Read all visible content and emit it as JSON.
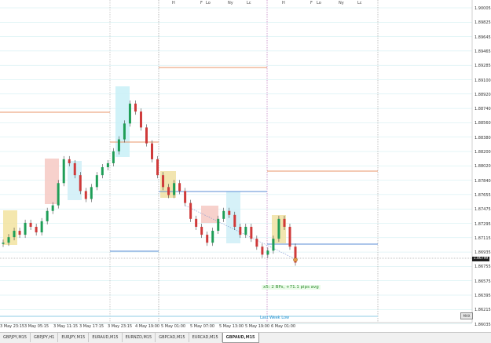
{
  "chart": {
    "symbol": "GBPAUD",
    "timeframe": "M15",
    "current_price_label": "1.86799",
    "stats_text": "x5: 2 BPs, +71.1 pips avg",
    "last_week_low_label": "Last Week Low",
    "corner_button": "MAX"
  },
  "session_labels": [
    "H",
    "F",
    "Lo",
    "Ny",
    "Lc",
    "H",
    "F",
    "Lo",
    "Ny",
    "Lc"
  ],
  "price_axis": [
    "1.90005",
    "1.89825",
    "1.89645",
    "1.89465",
    "1.89285",
    "1.89100",
    "1.88920",
    "1.88740",
    "1.88560",
    "1.88380",
    "1.88200",
    "1.88020",
    "1.87840",
    "1.87655",
    "1.87475",
    "1.87295",
    "1.87115",
    "1.86935",
    "1.86755",
    "1.86575",
    "1.86395",
    "1.86215",
    "1.86035"
  ],
  "time_axis": [
    "3 May 23:15",
    "3 May 05:15",
    "3 May 11:15",
    "3 May 17:15",
    "3 May 23:15",
    "4 May 19:00",
    "5 May 01:00",
    "5 May 07:00",
    "5 May 13:00",
    "5 May 19:00",
    "6 May 01:00"
  ],
  "tabs": [
    "GBPJPY,M15",
    "GBPJPY,H1",
    "EURJPY,M15",
    "EURAUD,M15",
    "EURNZD,M15",
    "GBPCAD,M15",
    "EURCAD,M15",
    "GBPAUD,M15"
  ],
  "active_tab": "GBPAUD,M15",
  "chart_data": {
    "type": "candlestick",
    "series": [
      {
        "values": [
          1.8705,
          1.8712,
          1.872,
          1.8715,
          1.873,
          1.8725,
          1.8718,
          1.8732,
          1.8745,
          1.8752,
          1.878,
          1.881,
          1.8805,
          1.879,
          1.877,
          1.876,
          1.8775,
          1.879,
          1.88,
          1.8805,
          1.882,
          1.8835,
          1.8855,
          1.888,
          1.887,
          1.885,
          1.883,
          1.881,
          1.879,
          1.8775,
          1.8765,
          1.878,
          1.877,
          1.8755,
          1.8735,
          1.8725,
          1.8715,
          1.8705,
          1.872,
          1.8735,
          1.8745,
          1.874,
          1.8725,
          1.8715,
          1.8725,
          1.871,
          1.87,
          1.869,
          1.8695,
          1.871,
          1.8735,
          1.8725,
          1.87,
          1.868
        ]
      }
    ],
    "price_range": [
      1.86035,
      1.90005
    ]
  }
}
